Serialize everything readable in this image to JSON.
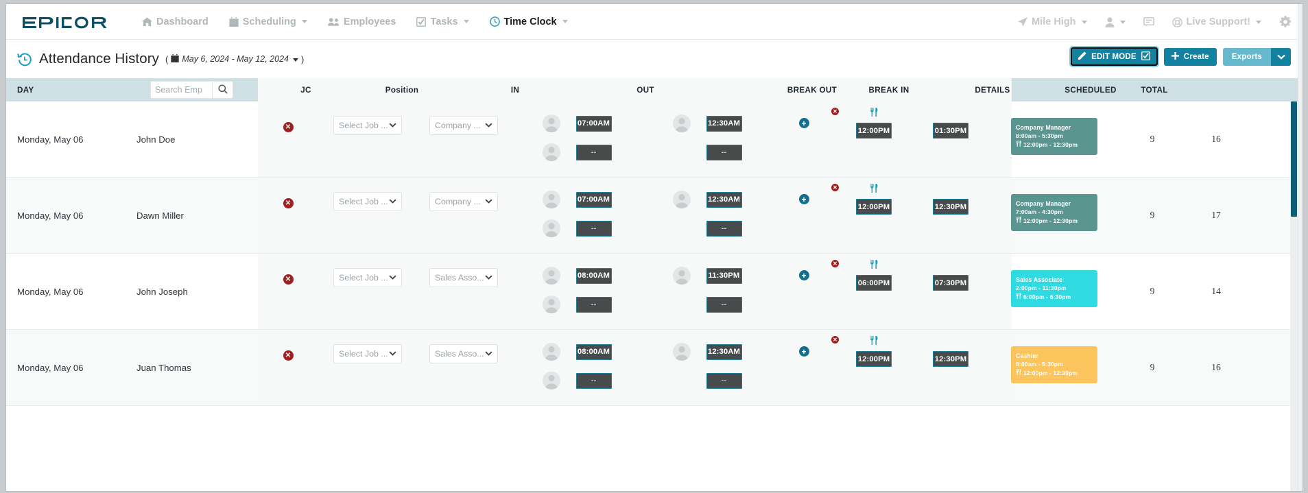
{
  "nav": {
    "brand": "EPICOR",
    "items": [
      {
        "label": "Dashboard",
        "icon": "home-icon",
        "caret": false,
        "active": false
      },
      {
        "label": "Scheduling",
        "icon": "calendar-icon",
        "caret": true,
        "active": false
      },
      {
        "label": "Employees",
        "icon": "users-icon",
        "caret": false,
        "active": false
      },
      {
        "label": "Tasks",
        "icon": "check-square-icon",
        "caret": true,
        "active": false
      },
      {
        "label": "Time Clock",
        "icon": "clock-icon",
        "caret": true,
        "active": true
      }
    ],
    "right": [
      {
        "label": "Mile High",
        "icon": "location-arrow-icon",
        "caret": true
      },
      {
        "label": "",
        "icon": "user-icon",
        "caret": true
      },
      {
        "label": "",
        "icon": "comment-icon",
        "caret": false
      },
      {
        "label": "Live Support!",
        "icon": "lifering-icon",
        "caret": true
      },
      {
        "label": "",
        "icon": "gear-icon",
        "caret": false
      }
    ]
  },
  "header": {
    "back_icon": "history-back-icon",
    "title": "Attendance History",
    "date_range": "May 6, 2024 - May 12, 2024",
    "calendar_icon": "calendar-icon",
    "buttons": {
      "edit_mode": "EDIT MODE",
      "edit_mode_icon": "pencil-icon",
      "edit_mode_checked": "checked-square-icon",
      "create": "Create",
      "create_icon": "plus-icon",
      "exports": "Exports",
      "exports_caret": "chevron-down-icon"
    }
  },
  "search": {
    "placeholder": "Search Emp",
    "value": "",
    "icon": "search-icon"
  },
  "columns": [
    {
      "key": "day",
      "label": "DAY"
    },
    {
      "key": "jc",
      "label": "JC"
    },
    {
      "key": "position",
      "label": "Position"
    },
    {
      "key": "in",
      "label": "IN"
    },
    {
      "key": "out",
      "label": "OUT"
    },
    {
      "key": "break_out",
      "label": "BREAK OUT"
    },
    {
      "key": "break_in",
      "label": "BREAK IN"
    },
    {
      "key": "details",
      "label": "DETAILS"
    },
    {
      "key": "scheduled",
      "label": "SCHEDULED"
    },
    {
      "key": "total",
      "label": "TOTAL"
    }
  ],
  "rows": [
    {
      "day": "Monday, May 06",
      "employee": "John Doe",
      "jc": "Select Job ...",
      "position": "Company ...",
      "in_1": "07:00AM",
      "in_2": "--",
      "out_1": "12:30AM",
      "out_2": "--",
      "break_out": "12:00PM",
      "break_in": "01:30PM",
      "details": {
        "title": "Company Manager",
        "shift": "8:00am - 5:30pm",
        "break": "12:00pm - 12:30pm",
        "color": "#5b9590"
      },
      "scheduled": "9",
      "total": "16"
    },
    {
      "day": "Monday, May 06",
      "employee": "Dawn Miller",
      "jc": "Select Job ...",
      "position": "Company ...",
      "in_1": "07:00AM",
      "in_2": "--",
      "out_1": "12:30AM",
      "out_2": "--",
      "break_out": "12:00PM",
      "break_in": "12:30PM",
      "details": {
        "title": "Company Manager",
        "shift": "7:00am - 4:30pm",
        "break": "12:00pm - 12:30pm",
        "color": "#5b9590"
      },
      "scheduled": "9",
      "total": "17"
    },
    {
      "day": "Monday, May 06",
      "employee": "John Joseph",
      "jc": "Select Job ...",
      "position": "Sales Asso...",
      "in_1": "08:00AM",
      "in_2": "--",
      "out_1": "11:30PM",
      "out_2": "--",
      "break_out": "06:00PM",
      "break_in": "07:30PM",
      "details": {
        "title": "Sales Associate",
        "shift": "2:00pm - 11:30pm",
        "break": "6:00pm - 6:30pm",
        "color": "#2fdbe0"
      },
      "scheduled": "9",
      "total": "14"
    },
    {
      "day": "Monday, May 06",
      "employee": "Juan Thomas",
      "jc": "Select Job ...",
      "position": "Sales Asso...",
      "in_1": "08:00AM",
      "in_2": "--",
      "out_1": "12:30AM",
      "out_2": "--",
      "break_out": "12:00PM",
      "break_in": "12:30PM",
      "details": {
        "title": "Cashier",
        "shift": "8:00am - 5:30pm",
        "break": "12:00pm - 12:30pm",
        "color": "#fbc45c"
      },
      "scheduled": "9",
      "total": "16"
    }
  ],
  "theme": {
    "accent": "#1382a0",
    "header_bg": "#cfe0e4",
    "chip_bg": "#484b4c",
    "delete_red": "#a02020"
  }
}
